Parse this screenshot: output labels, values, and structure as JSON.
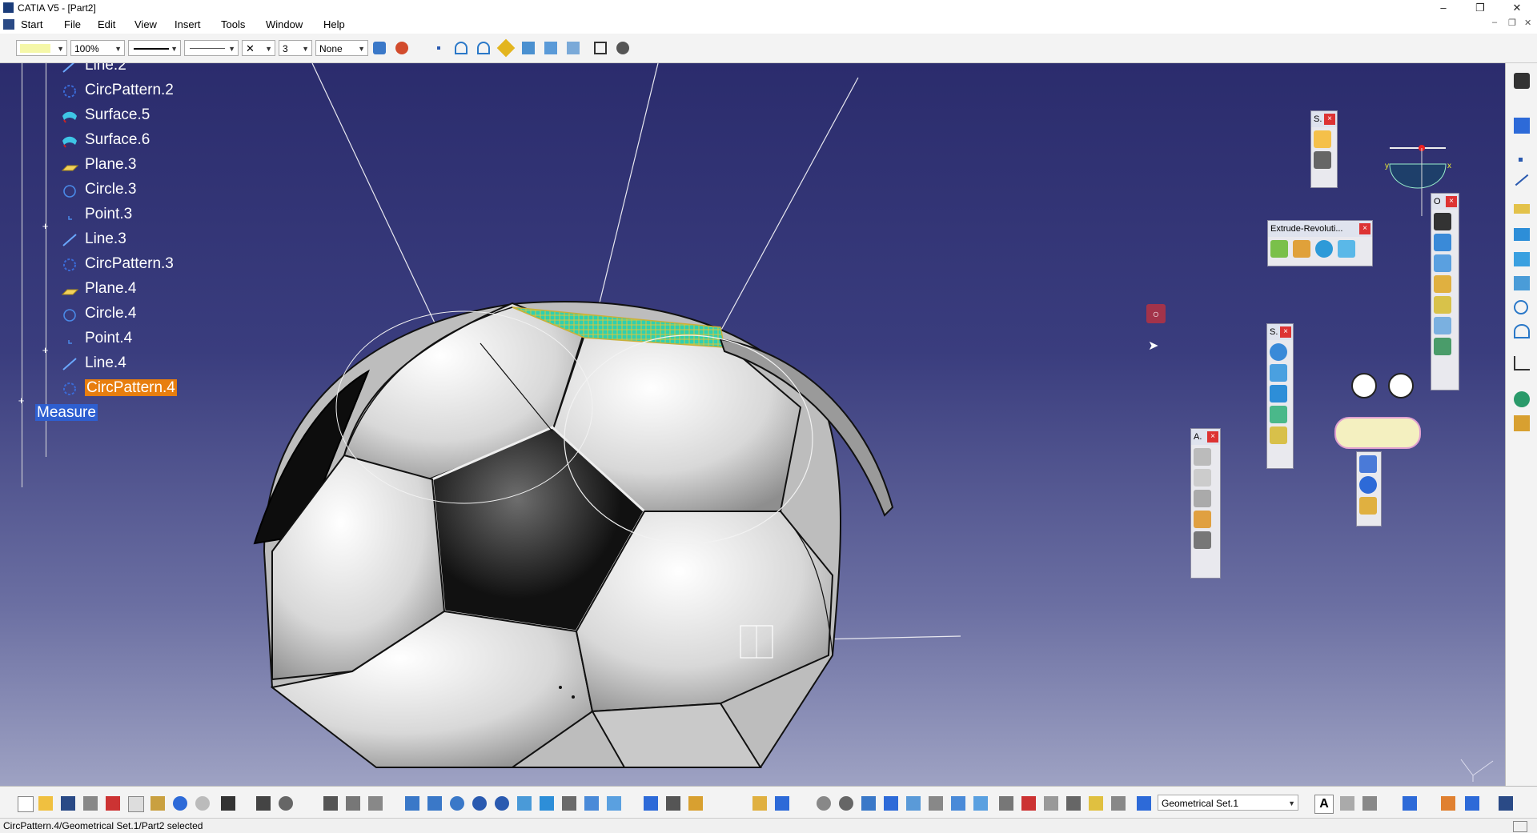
{
  "window": {
    "title": "CATIA V5 - [Part2]",
    "controls": [
      "–",
      "❐",
      "✕"
    ]
  },
  "menu": {
    "items": [
      {
        "label": "Start",
        "key": "S"
      },
      {
        "label": "File",
        "key": "F"
      },
      {
        "label": "Edit",
        "key": "E"
      },
      {
        "label": "View",
        "key": "V"
      },
      {
        "label": "Insert",
        "key": "I"
      },
      {
        "label": "Tools",
        "key": "T"
      },
      {
        "label": "Window",
        "key": "W"
      },
      {
        "label": "Help",
        "key": "H"
      }
    ]
  },
  "toolbar": {
    "zoom_value": "100%",
    "layer_value": "None",
    "line_weight_value": "3"
  },
  "tree": {
    "items": [
      {
        "label": "Line.2",
        "type": "line"
      },
      {
        "label": "CircPattern.2",
        "type": "pattern"
      },
      {
        "label": "Surface.5",
        "type": "surface"
      },
      {
        "label": "Surface.6",
        "type": "surface"
      },
      {
        "label": "Plane.3",
        "type": "plane"
      },
      {
        "label": "Circle.3",
        "type": "circle"
      },
      {
        "label": "Point.3",
        "type": "point"
      },
      {
        "label": "Line.3",
        "type": "line"
      },
      {
        "label": "CircPattern.3",
        "type": "pattern"
      },
      {
        "label": "Plane.4",
        "type": "plane"
      },
      {
        "label": "Circle.4",
        "type": "circle"
      },
      {
        "label": "Point.4",
        "type": "point"
      },
      {
        "label": "Line.4",
        "type": "line"
      },
      {
        "label": "CircPattern.4",
        "type": "pattern"
      }
    ],
    "measure_label": "Measure"
  },
  "floating_toolbars": {
    "select_short": "S.",
    "extrude_title": "Extrude-Revoluti...",
    "ops_short": "O",
    "surfaces_short": "S.",
    "annotations_short": "A."
  },
  "bottom": {
    "geometrical_set": "Geometrical Set.1",
    "text_tool": "A"
  },
  "status": {
    "text": "CircPattern.4/Geometrical Set.1/Part2 selected"
  },
  "colors": {
    "viewport_top": "#2b2c6d",
    "viewport_bottom": "#9ea2c3",
    "selection_orange": "#e87e0e",
    "selection_blue": "#2e5fd0"
  }
}
